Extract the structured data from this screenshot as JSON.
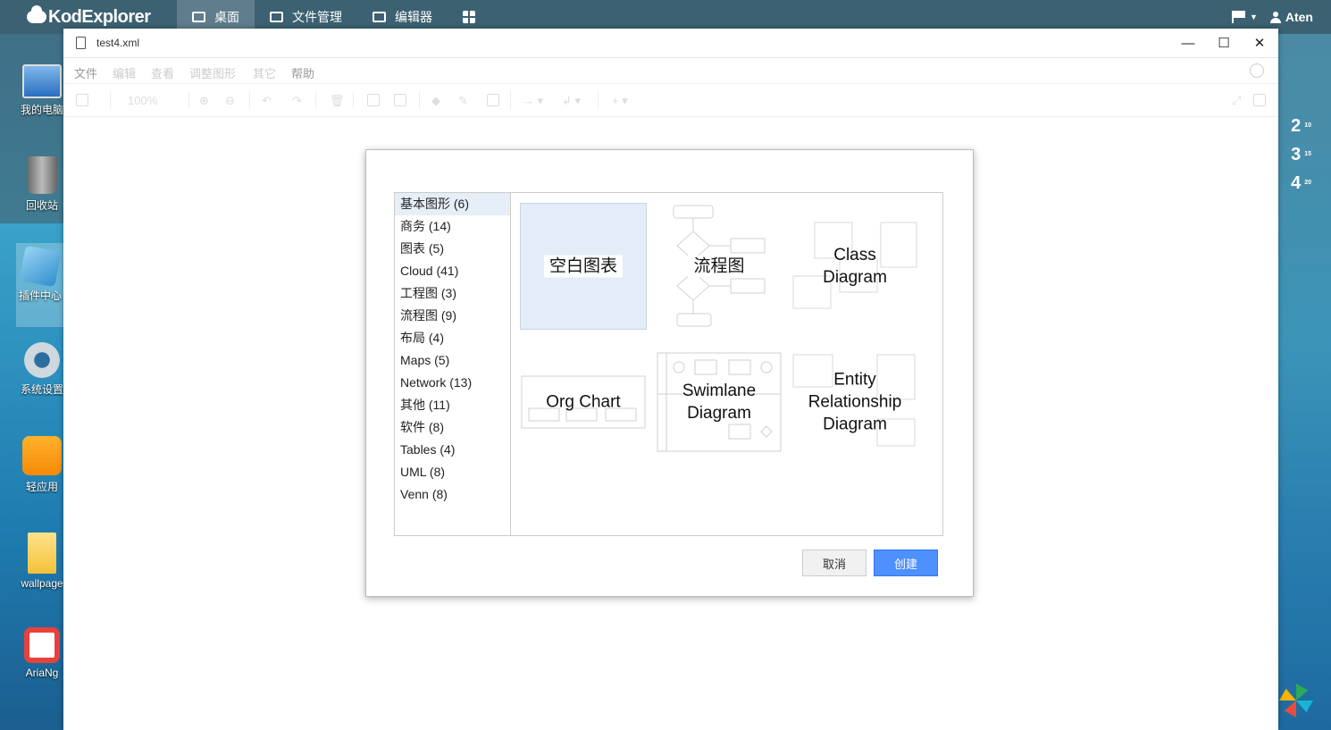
{
  "app": {
    "brand": "KodExplorer",
    "user": "Aten"
  },
  "taskbar": {
    "tabs": [
      {
        "label": "桌面",
        "icon": "monitor-icon",
        "active": true
      },
      {
        "label": "文件管理",
        "icon": "folder-list-icon",
        "active": false
      },
      {
        "label": "编辑器",
        "icon": "edit-icon",
        "active": false
      },
      {
        "label": "",
        "icon": "apps-grid-icon",
        "active": false
      }
    ]
  },
  "desktop": {
    "icons": [
      {
        "label": "我的电脑",
        "icon": "computer-icon"
      },
      {
        "label": "回收站",
        "icon": "recycle-bin-icon"
      },
      {
        "label": "插件中心",
        "icon": "plugin-center-icon"
      },
      {
        "label": "系统设置",
        "icon": "settings-gear-icon"
      },
      {
        "label": "轻应用",
        "icon": "shopping-bag-icon"
      },
      {
        "label": "wallpage",
        "icon": "folder-icon"
      },
      {
        "label": "AriaNg",
        "icon": "ariang-icon"
      }
    ]
  },
  "clock": {
    "h1": "2",
    "m1": "10",
    "h2": "3",
    "m2": "15",
    "h3": "4",
    "m3": "20"
  },
  "window": {
    "title": "test4.xml",
    "menus": [
      "文件",
      "编辑",
      "查看",
      "调整图形",
      "其它",
      "帮助"
    ],
    "zoom": "100%"
  },
  "dialog": {
    "categories": [
      "基本图形 (6)",
      "商务 (14)",
      "图表 (5)",
      "Cloud (41)",
      "工程图 (3)",
      "流程图 (9)",
      "布局 (4)",
      "Maps (5)",
      "Network (13)",
      "其他 (11)",
      "软件 (8)",
      "Tables (4)",
      "UML (8)",
      "Venn (8)"
    ],
    "templates": [
      {
        "label": "空白图表"
      },
      {
        "label": "流程图"
      },
      {
        "label_line1": "Class",
        "label_line2": "Diagram"
      },
      {
        "label": "Org Chart"
      },
      {
        "label_line1": "Swimlane",
        "label_line2": "Diagram"
      },
      {
        "label_line1": "Entity",
        "label_line2": "Relationship",
        "label_line3": "Diagram"
      }
    ],
    "cancel": "取消",
    "create": "创建"
  },
  "colors": {
    "accent": "#4d90fe",
    "selected_bg": "#e4ecf7",
    "taskbar": "#3c5f70"
  }
}
